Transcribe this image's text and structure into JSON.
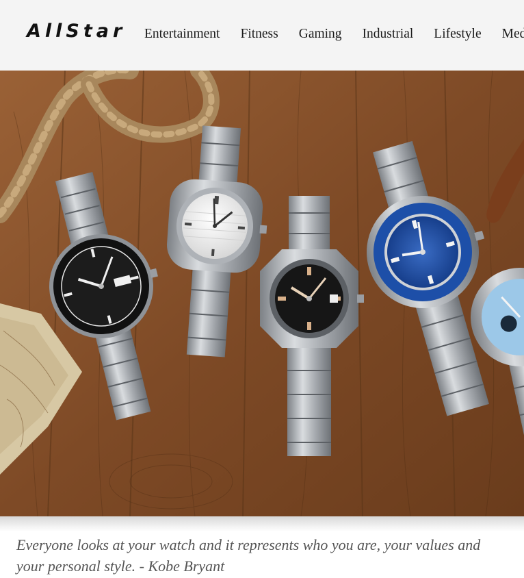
{
  "header": {
    "logo": "AllStar",
    "nav": [
      "Entertainment",
      "Fitness",
      "Gaming",
      "Industrial",
      "Lifestyle",
      "Med"
    ]
  },
  "hero": {
    "image_subject": "watches-on-wood",
    "colors": {
      "wood": "#8a5530",
      "wood_dark": "#5a3418",
      "steel": "#b8bcc0",
      "bezel_blue": "#1d4fa8",
      "dial_black": "#1a1a1a",
      "dial_white": "#f2f2f2",
      "dial_light_blue": "#9cc8e8"
    }
  },
  "quote": {
    "text": "Everyone looks at your watch and it represents who you are, your values and your personal style. - Kobe Bryant"
  },
  "colors": {
    "header_bg": "#f4f4f4",
    "text": "#1a1a1a",
    "quote": "#555555"
  }
}
